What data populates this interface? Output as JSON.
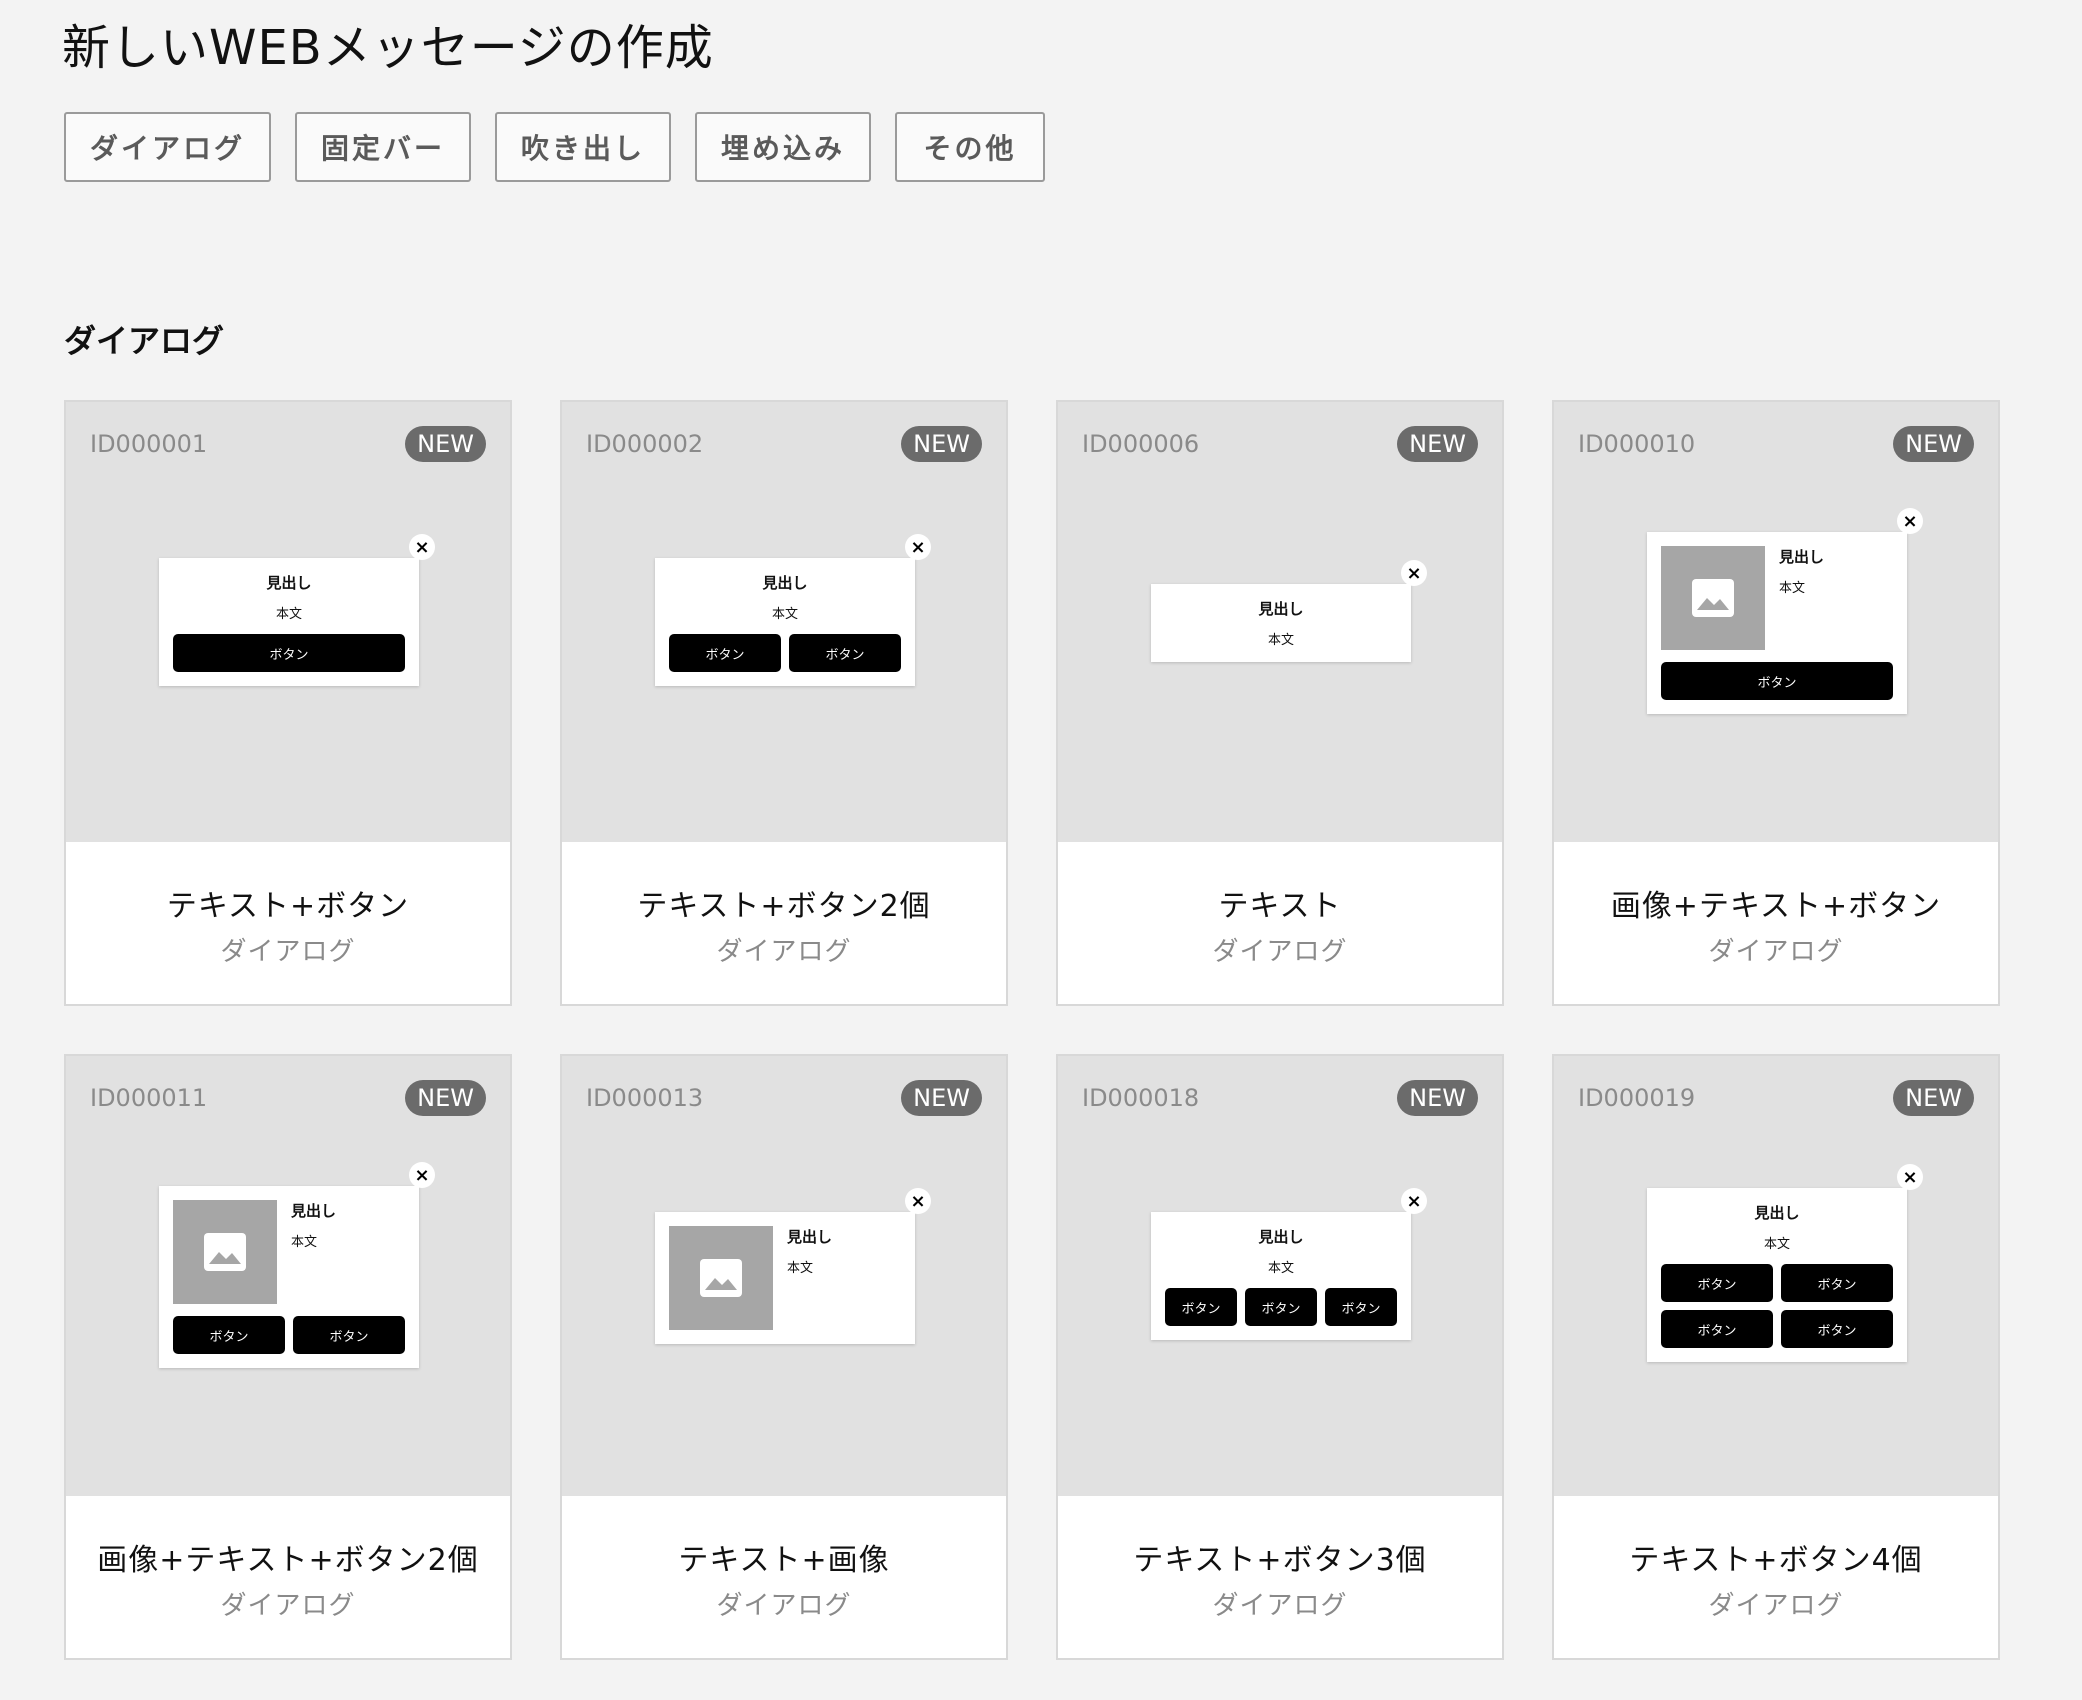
{
  "page": {
    "title": "新しいWEBメッセージの作成"
  },
  "filters": [
    "ダイアログ",
    "固定バー",
    "吹き出し",
    "埋め込み",
    "その他"
  ],
  "section": {
    "title": "ダイアログ"
  },
  "mock": {
    "heading": "見出し",
    "body": "本文",
    "button": "ボタン",
    "close": "×"
  },
  "cards": [
    {
      "id": "ID000001",
      "badge": "NEW",
      "name": "テキスト+ボタン",
      "type": "ダイアログ"
    },
    {
      "id": "ID000002",
      "badge": "NEW",
      "name": "テキスト+ボタン2個",
      "type": "ダイアログ"
    },
    {
      "id": "ID000006",
      "badge": "NEW",
      "name": "テキスト",
      "type": "ダイアログ"
    },
    {
      "id": "ID000010",
      "badge": "NEW",
      "name": "画像+テキスト+ボタン",
      "type": "ダイアログ"
    },
    {
      "id": "ID000011",
      "badge": "NEW",
      "name": "画像+テキスト+ボタン2個",
      "type": "ダイアログ"
    },
    {
      "id": "ID000013",
      "badge": "NEW",
      "name": "テキスト+画像",
      "type": "ダイアログ"
    },
    {
      "id": "ID000018",
      "badge": "NEW",
      "name": "テキスト+ボタン3個",
      "type": "ダイアログ"
    },
    {
      "id": "ID000019",
      "badge": "NEW",
      "name": "テキスト+ボタン4個",
      "type": "ダイアログ"
    }
  ]
}
